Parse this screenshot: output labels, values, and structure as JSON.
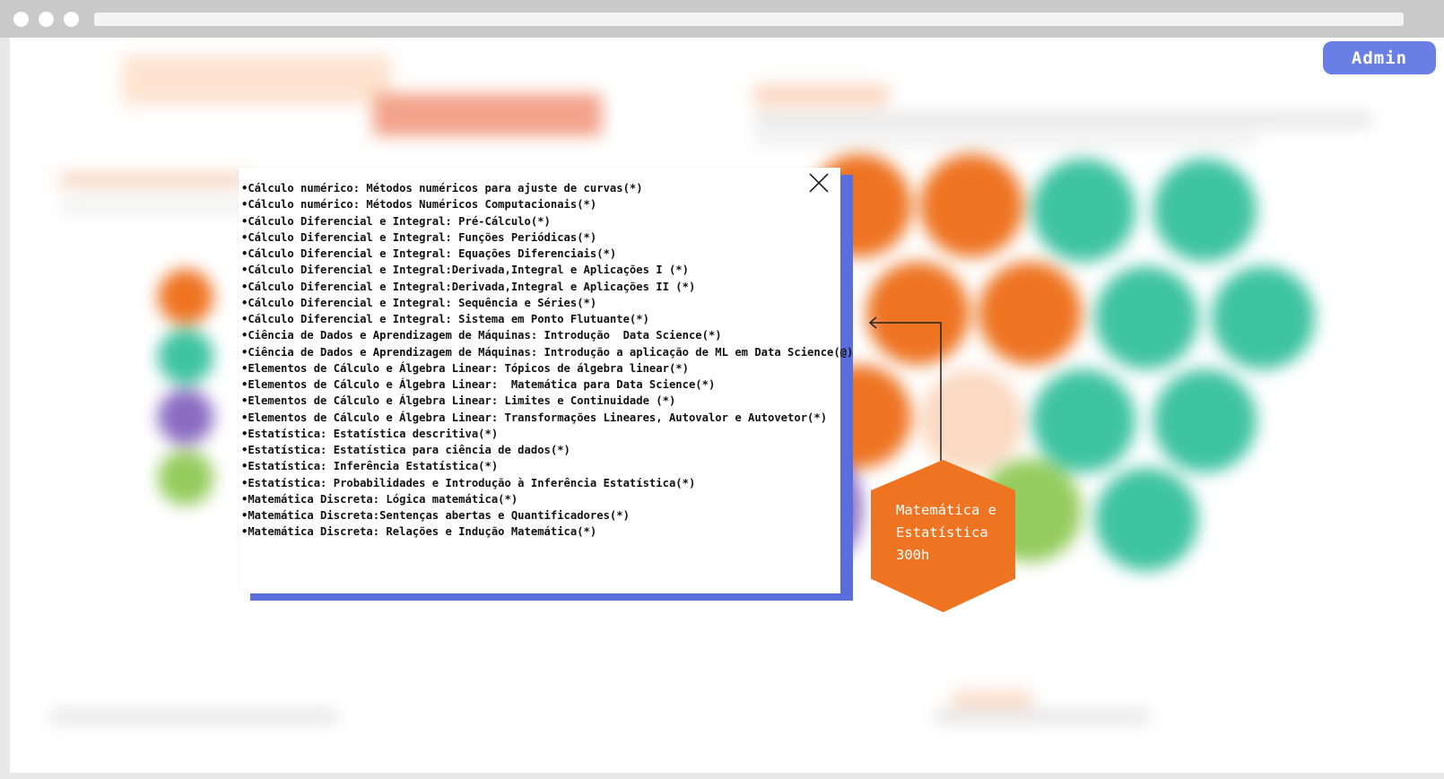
{
  "header": {
    "admin_label": "Admin"
  },
  "colors": {
    "accent_blue": "#6a7fe6",
    "orange": "#ee7422",
    "teal": "#3ec3a0",
    "purple": "#8a6cc2",
    "green": "#95cc5e"
  },
  "icons": {
    "close": "close-icon",
    "arrow": "arrow-left-icon"
  },
  "modal": {
    "courses": [
      "Cálculo numérico: Métodos numéricos para ajuste de curvas(*)",
      "Cálculo numérico: Métodos Numéricos Computacionais(*)",
      "Cálculo Diferencial e Integral: Pré-Cálculo(*)",
      "Cálculo Diferencial e Integral: Funções Periódicas(*)",
      "Cálculo Diferencial e Integral: Equações Diferenciais(*)",
      "Cálculo Diferencial e Integral:Derivada,Integral e Aplicações I (*)",
      "Cálculo Diferencial e Integral:Derivada,Integral e Aplicações II (*)",
      "Cálculo Diferencial e Integral: Sequência e Séries(*)",
      "Cálculo Diferencial e Integral: Sistema em Ponto Flutuante(*)",
      "Ciência de Dados e Aprendizagem de Máquinas: Introdução  Data Science(*)",
      "Ciência de Dados e Aprendizagem de Máquinas: Introdução a aplicação de ML em Data Science(@)",
      "Elementos de Cálculo e Álgebra Linear: Tópicos de álgebra linear(*)",
      "Elementos de Cálculo e Álgebra Linear:  Matemática para Data Science(*)",
      "Elementos de Cálculo e Álgebra Linear: Limites e Continuidade (*)",
      "Elementos de Cálculo e Álgebra Linear: Transformações Lineares, Autovalor e Autovetor(*)",
      "Estatística: Estatística descritiva(*)",
      "Estatística: Estatística para ciência de dados(*)",
      "Estatística: Inferência Estatística(*)",
      "Estatística: Probabilidades e Introdução à Inferência Estatística(*)",
      "Matemática Discreta: Lógica matemática(*)",
      "Matemática Discreta:Sentenças abertas e Quantificadores(*)",
      "Matemática Discreta: Relações e Indução Matemática(*)"
    ]
  },
  "hexagon": {
    "title_line1": "Matemática e",
    "title_line2": "Estatística",
    "hours": "300h"
  }
}
